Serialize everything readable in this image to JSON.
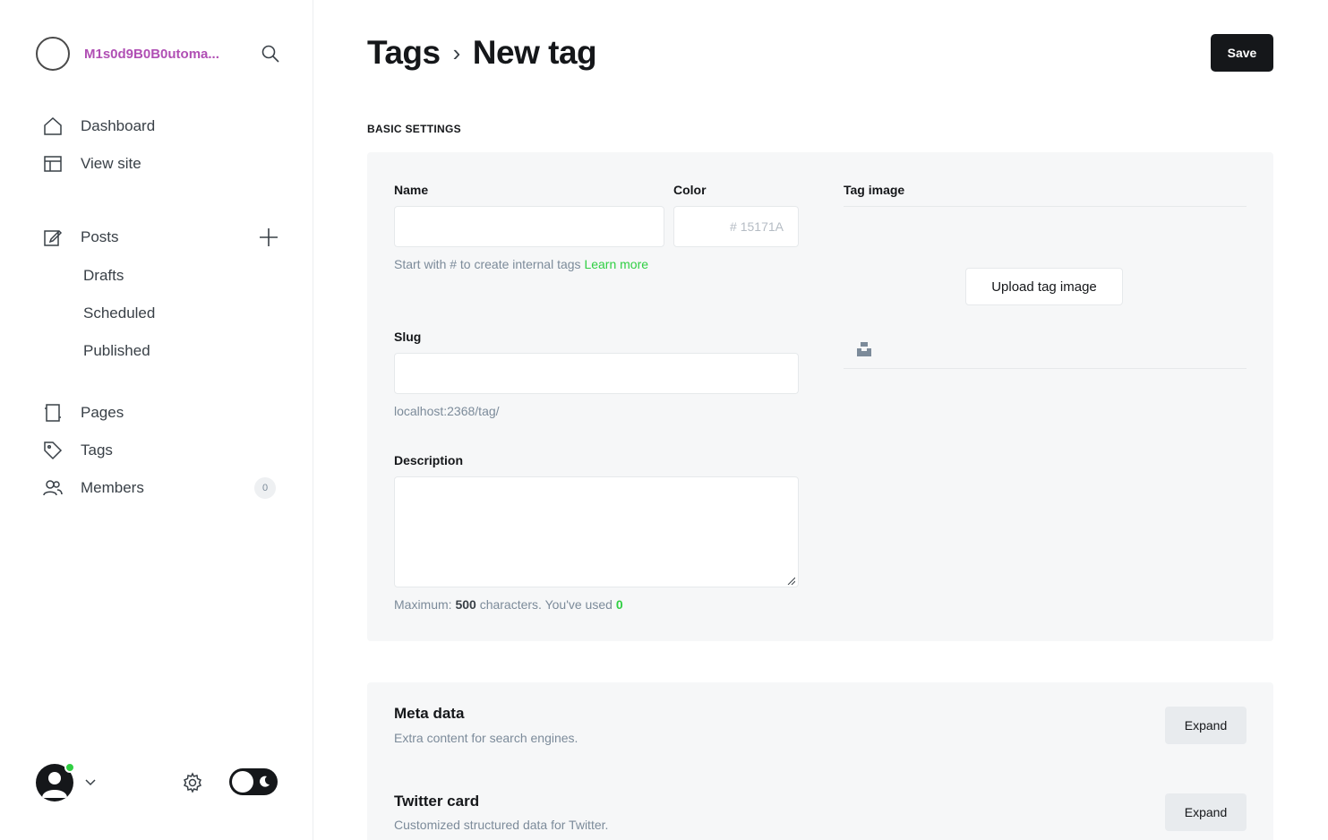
{
  "sidebar": {
    "site_name": "M1s0d9B0B0utoma...",
    "nav": {
      "dashboard": "Dashboard",
      "view_site": "View site",
      "posts": "Posts",
      "drafts": "Drafts",
      "scheduled": "Scheduled",
      "published": "Published",
      "pages": "Pages",
      "tags": "Tags",
      "members": "Members",
      "members_count": "0"
    },
    "icons": [
      "search-icon",
      "home-icon",
      "layout-icon",
      "edit-icon",
      "plus-icon",
      "page-icon",
      "tag-icon",
      "members-icon",
      "gear-icon",
      "moon-icon",
      "chevron-down-icon"
    ]
  },
  "header": {
    "breadcrumb_parent": "Tags",
    "separator": "›",
    "title": "New tag",
    "save_label": "Save"
  },
  "basic_settings": {
    "section_label": "BASIC SETTINGS",
    "name_label": "Name",
    "name_value": "",
    "color_label": "Color",
    "color_placeholder": "# 15171A",
    "name_hint": "Start with # to create internal tags",
    "name_hint_link": "Learn more",
    "slug_label": "Slug",
    "slug_value": "",
    "slug_hint": "localhost:2368/tag/",
    "description_label": "Description",
    "description_value": "",
    "description_hint_prefix": "Maximum: ",
    "description_max": "500",
    "description_hint_middle": " characters. You've used ",
    "description_used": "0",
    "tag_image_label": "Tag image",
    "upload_label": "Upload tag image"
  },
  "expandables": {
    "meta_title": "Meta data",
    "meta_sub": "Extra content for search engines.",
    "twitter_title": "Twitter card",
    "twitter_sub": "Customized structured data for Twitter.",
    "expand_label": "Expand"
  },
  "colors": {
    "accent_green": "#30cf43",
    "brand_pink": "#b04fb4",
    "dark": "#15171a",
    "card_bg": "#f6f7f8"
  }
}
